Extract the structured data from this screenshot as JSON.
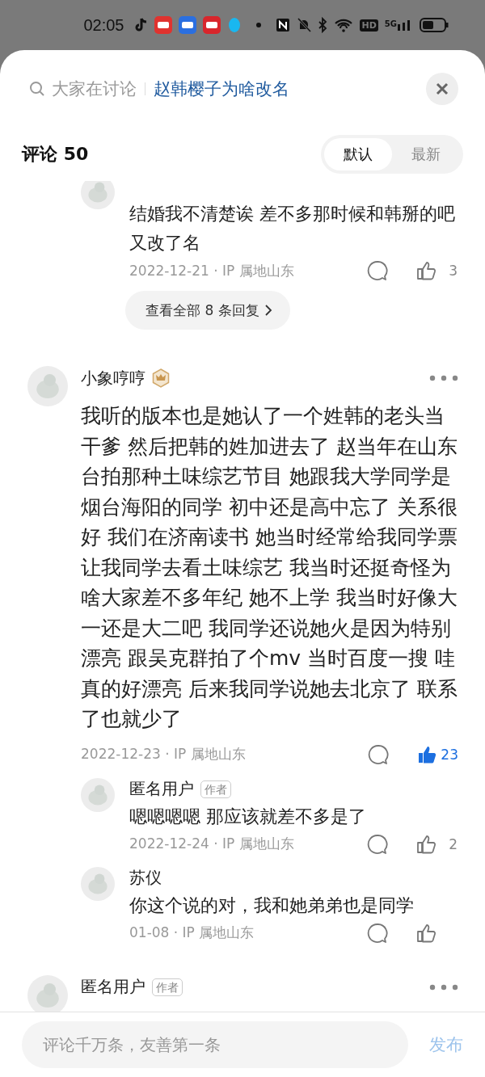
{
  "status_bar": {
    "time": "02:05",
    "hd_label": "HD",
    "network_label": "5G"
  },
  "topic_bar": {
    "prefix": "大家在讨论",
    "topic": "赵韩樱子为啥改名"
  },
  "header": {
    "title": "评论 50",
    "sort_tabs": [
      {
        "label": "默认",
        "selected": true
      },
      {
        "label": "最新",
        "selected": false
      }
    ]
  },
  "threads": [
    {
      "replies": [
        {
          "text": "结婚我不清楚诶 差不多那时候和韩掰的吧又改了名",
          "date": "2022-12-21 · IP 属地山东",
          "likes": "3",
          "liked": false
        }
      ],
      "more_replies": "查看全部 8 条回复"
    },
    {
      "author": "小象哼哼",
      "badge": true,
      "text": "我听的版本也是她认了一个姓韩的老头当干爹 然后把韩的姓加进去了 赵当年在山东台拍那种土味综艺节目 她跟我大学同学是烟台海阳的同学 初中还是高中忘了 关系很好 我们在济南读书 她当时经常给我同学票让我同学去看土味综艺 我当时还挺奇怪为啥大家差不多年纪 她不上学 我当时好像大一还是大二吧 我同学还说她火是因为特别漂亮 跟吴克群拍了个mv 当时百度一搜 哇真的好漂亮 后来我同学说她去北京了 联系了也就少了",
      "date": "2022-12-23 · IP 属地山东",
      "likes": "23",
      "liked": true,
      "replies": [
        {
          "author": "匿名用户",
          "author_tag": "作者",
          "text": "嗯嗯嗯嗯 那应该就差不多是了",
          "date": "2022-12-24 · IP 属地山东",
          "likes": "2",
          "liked": false
        },
        {
          "author": "苏仪",
          "text": "你这个说的对，我和她弟弟也是同学",
          "date": "01-08 · IP 属地山东",
          "liked": false
        }
      ]
    },
    {
      "author": "匿名用户",
      "author_tag": "作者"
    }
  ],
  "composer": {
    "placeholder": "评论千万条，友善第一条",
    "send_label": "发布",
    "send_disabled": true
  }
}
